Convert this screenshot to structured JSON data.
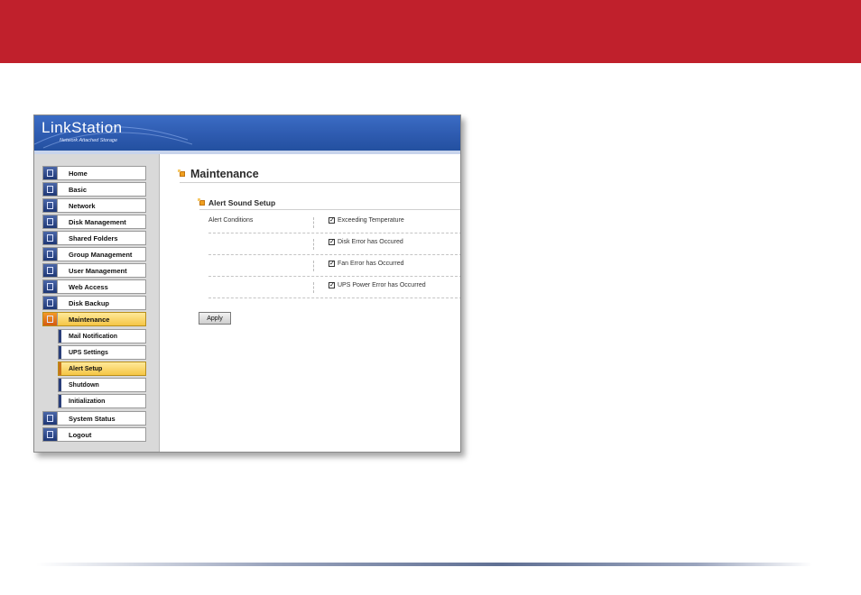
{
  "app": {
    "title": "LinkStation",
    "subtitle": "Network Attached Storage"
  },
  "nav": [
    {
      "label": "Home"
    },
    {
      "label": "Basic"
    },
    {
      "label": "Network"
    },
    {
      "label": "Disk Management"
    },
    {
      "label": "Shared Folders"
    },
    {
      "label": "Group Management"
    },
    {
      "label": "User Management"
    },
    {
      "label": "Web Access"
    },
    {
      "label": "Disk Backup"
    },
    {
      "label": "Maintenance"
    },
    {
      "label": "System Status"
    },
    {
      "label": "Logout"
    }
  ],
  "subnav": [
    {
      "label": "Mail Notification"
    },
    {
      "label": "UPS Settings"
    },
    {
      "label": "Alert Setup"
    },
    {
      "label": "Shutdown"
    },
    {
      "label": "Initialization"
    }
  ],
  "page": {
    "title": "Maintenance",
    "section": "Alert Sound Setup",
    "conditions_label": "Alert Conditions",
    "conditions": [
      {
        "label": "Exceeding Temperature",
        "checked": true
      },
      {
        "label": "Disk Error has Occured",
        "checked": true
      },
      {
        "label": "Fan Error has Occurred",
        "checked": true
      },
      {
        "label": "UPS Power Error has Occurred",
        "checked": true
      }
    ],
    "apply_label": "Apply"
  },
  "colors": {
    "banner": "#c0202c",
    "header": "#2e5bb0",
    "active": "#f5c545"
  }
}
